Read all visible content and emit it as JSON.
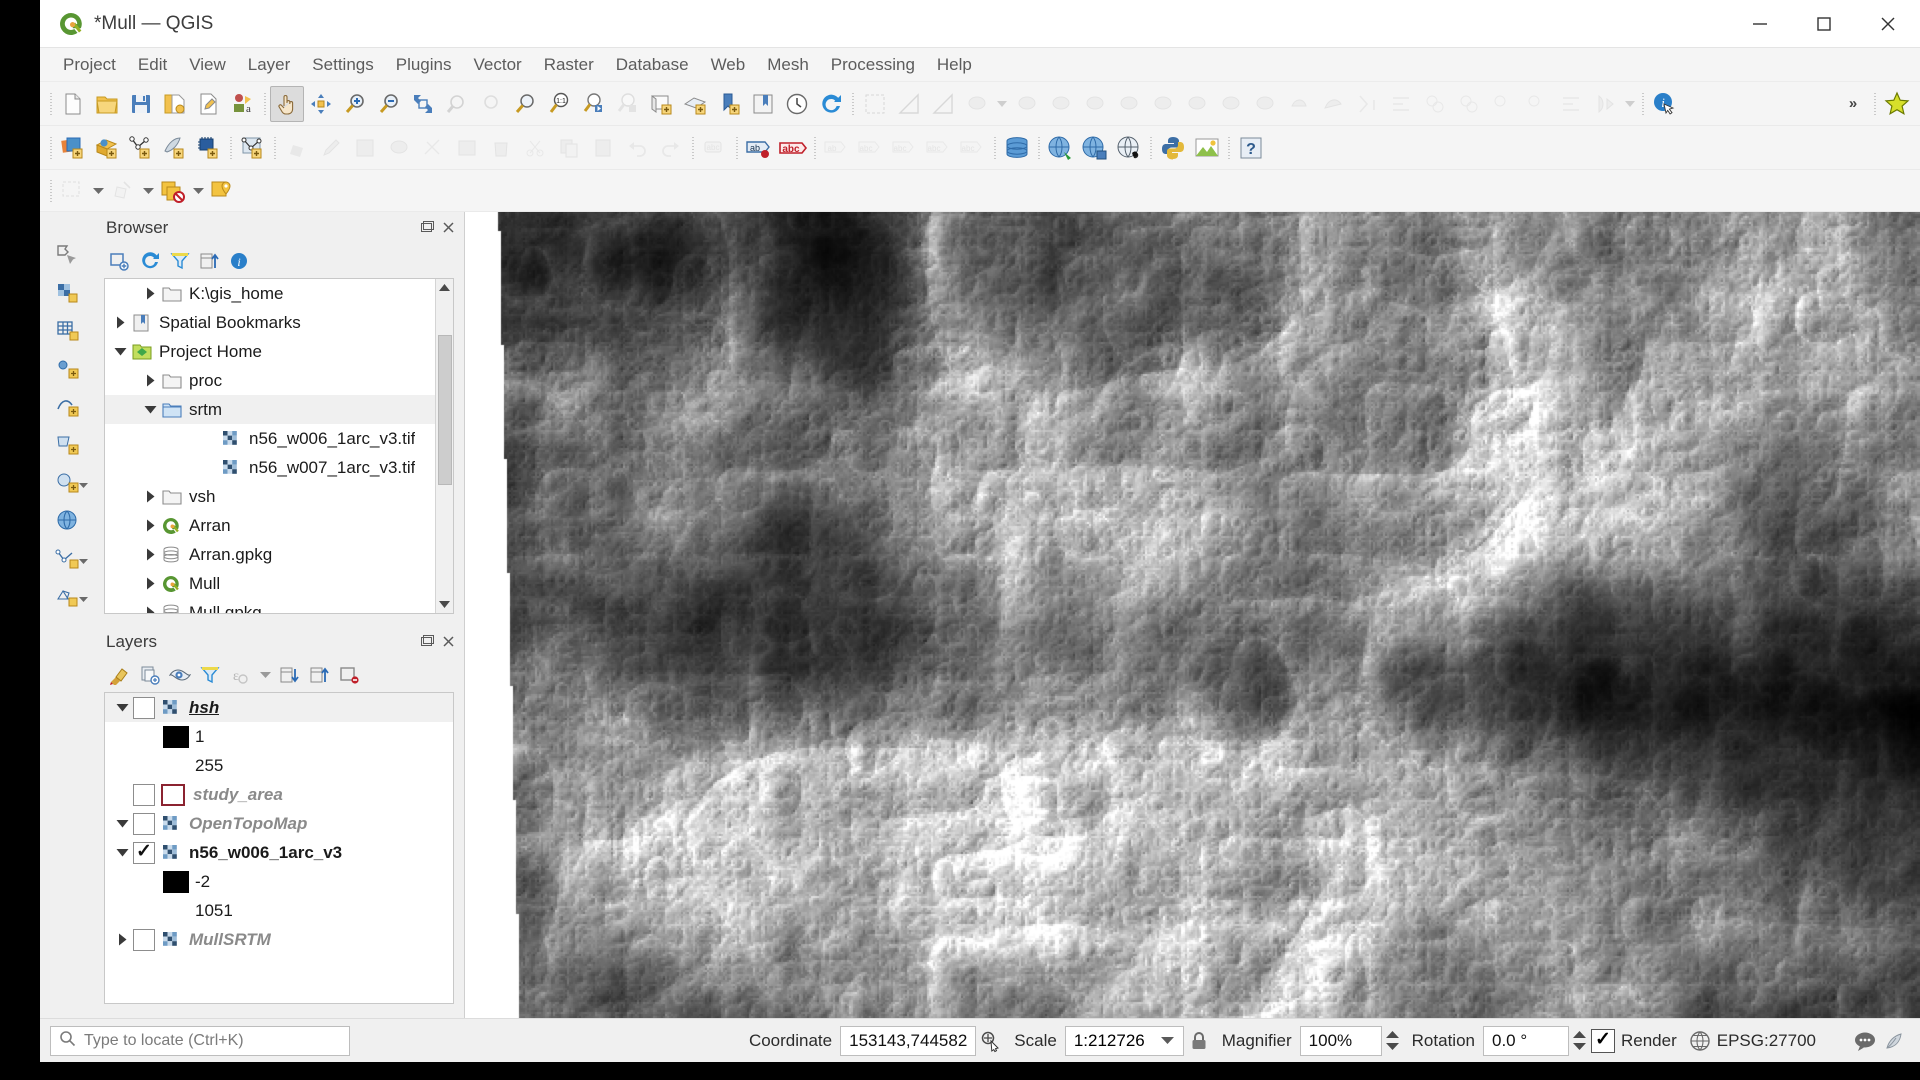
{
  "window": {
    "title": "*Mull — QGIS",
    "logo_icon": "qgis-logo-icon",
    "minimize_label": "—",
    "maximize_label": "▢",
    "close_label": "✕"
  },
  "menubar": {
    "items": [
      {
        "label": "Project"
      },
      {
        "label": "Edit"
      },
      {
        "label": "View"
      },
      {
        "label": "Layer"
      },
      {
        "label": "Settings"
      },
      {
        "label": "Plugins"
      },
      {
        "label": "Vector"
      },
      {
        "label": "Raster"
      },
      {
        "label": "Database"
      },
      {
        "label": "Web"
      },
      {
        "label": "Mesh"
      },
      {
        "label": "Processing"
      },
      {
        "label": "Help"
      }
    ]
  },
  "toolbar_project": {
    "items": [
      {
        "name": "new-project-icon",
        "enabled": true
      },
      {
        "name": "open-project-icon",
        "enabled": true
      },
      {
        "name": "save-project-icon",
        "enabled": true
      },
      {
        "name": "save-project-as-icon",
        "enabled": true
      },
      {
        "name": "project-properties-icon",
        "enabled": true
      },
      {
        "name": "style-manager-icon",
        "enabled": true
      },
      {
        "name": "pan-map-icon",
        "enabled": true,
        "pressed": true
      },
      {
        "name": "pan-to-selection-icon",
        "enabled": true
      },
      {
        "name": "zoom-in-icon",
        "enabled": true
      },
      {
        "name": "zoom-out-icon",
        "enabled": true
      },
      {
        "name": "zoom-full-icon",
        "enabled": true
      },
      {
        "name": "zoom-to-selection-icon",
        "enabled": false
      },
      {
        "name": "zoom-to-layer-icon",
        "enabled": true
      },
      {
        "name": "zoom-native-resolution-icon",
        "enabled": true
      },
      {
        "name": "zoom-last-icon",
        "enabled": true
      },
      {
        "name": "zoom-next-icon",
        "enabled": false
      },
      {
        "name": "new-map-view-icon",
        "enabled": true
      },
      {
        "name": "new-3d-map-view-icon",
        "enabled": true
      },
      {
        "name": "new-bookmark-icon",
        "enabled": true
      },
      {
        "name": "show-bookmarks-icon",
        "enabled": true
      },
      {
        "name": "temporal-controller-icon",
        "enabled": true
      },
      {
        "name": "refresh-icon",
        "enabled": true
      },
      {
        "name": "identify-features-icon",
        "enabled": true
      },
      {
        "name": "measure-line-icon",
        "enabled": false
      },
      {
        "name": "measure-area-icon",
        "enabled": false
      }
    ],
    "overflow_label": "»"
  },
  "toolbar_digitizing": {
    "items": [
      {
        "name": "add-vector-layer-icon",
        "enabled": true
      },
      {
        "name": "add-raster-layer-icon",
        "enabled": true
      },
      {
        "name": "add-delimited-text-layer-icon",
        "enabled": true
      },
      {
        "name": "add-spatialite-layer-icon",
        "enabled": true
      },
      {
        "name": "add-postgis-layer-icon",
        "enabled": true
      },
      {
        "name": "add-mesh-layer-icon",
        "enabled": true
      },
      {
        "name": "current-edits-icon",
        "enabled": false
      },
      {
        "name": "toggle-editing-icon",
        "enabled": false
      },
      {
        "name": "save-layer-edits-icon",
        "enabled": false
      },
      {
        "name": "add-polygon-feature-icon",
        "enabled": false
      },
      {
        "name": "vertex-tool-icon",
        "enabled": false
      },
      {
        "name": "modify-attributes-icon",
        "enabled": false
      },
      {
        "name": "delete-selected-icon",
        "enabled": false
      },
      {
        "name": "cut-features-icon",
        "enabled": false
      },
      {
        "name": "copy-features-icon",
        "enabled": false
      },
      {
        "name": "paste-features-icon",
        "enabled": false
      },
      {
        "name": "undo-icon",
        "enabled": false
      },
      {
        "name": "redo-icon",
        "enabled": false
      },
      {
        "name": "label-toggle-icon",
        "enabled": false
      },
      {
        "name": "layer-labeling-options-icon",
        "enabled": true
      },
      {
        "name": "highlight-pinned-labels-icon",
        "enabled": true
      },
      {
        "name": "pin-labels-icon",
        "enabled": false
      },
      {
        "name": "show-hide-labels-icon",
        "enabled": false
      },
      {
        "name": "move-label-icon",
        "enabled": false
      },
      {
        "name": "rotate-label-icon",
        "enabled": false
      },
      {
        "name": "change-label-icon",
        "enabled": false
      },
      {
        "name": "database-manager-icon",
        "enabled": true
      },
      {
        "name": "metasearch-icon",
        "enabled": true
      },
      {
        "name": "qgis-server-icon",
        "enabled": true
      },
      {
        "name": "georeferencer-icon",
        "enabled": true
      },
      {
        "name": "python-console-icon",
        "enabled": true
      },
      {
        "name": "plugin-manager-icon",
        "enabled": true
      },
      {
        "name": "help-contents-icon",
        "enabled": true
      }
    ]
  },
  "toolbar_selection": {
    "items": [
      {
        "name": "select-features-icon",
        "enabled": false
      },
      {
        "name": "deselect-features-icon",
        "enabled": true
      },
      {
        "name": "select-by-value-icon",
        "enabled": true
      },
      {
        "name": "select-by-location-icon",
        "enabled": true
      }
    ]
  },
  "rail": {
    "items": [
      {
        "name": "rail-item-select-features",
        "icon": "select-polygon-icon"
      },
      {
        "name": "rail-item-raster-calculator",
        "icon": "raster-icon"
      },
      {
        "name": "rail-item-vector-grid",
        "icon": "grid-icon"
      },
      {
        "name": "rail-item-add-point",
        "icon": "add-point-icon"
      },
      {
        "name": "rail-item-add-line",
        "icon": "add-line-icon"
      },
      {
        "name": "rail-item-add-polygon",
        "icon": "add-polygon-icon"
      },
      {
        "name": "rail-item-add-circle",
        "icon": "add-circle-icon"
      },
      {
        "name": "rail-item-globe",
        "icon": "globe-icon"
      },
      {
        "name": "rail-item-vertex-tool",
        "icon": "vertex-tool-icon"
      },
      {
        "name": "rail-item-mesh",
        "icon": "mesh-icon"
      }
    ]
  },
  "browser_panel": {
    "title": "Browser",
    "toolbar": [
      {
        "name": "add-layer-icon"
      },
      {
        "name": "refresh-icon"
      },
      {
        "name": "filter-browser-icon"
      },
      {
        "name": "collapse-all-icon"
      },
      {
        "name": "show-properties-icon"
      }
    ],
    "tree": [
      {
        "label": "K:\\gis_home",
        "icon": "folder-icon",
        "indent": 2,
        "twisty": "collapsed",
        "style": "normal"
      },
      {
        "label": "Spatial Bookmarks",
        "icon": "bookmarks-icon",
        "indent": 1,
        "twisty": "collapsed",
        "style": "normal"
      },
      {
        "label": "Project Home",
        "icon": "project-home-icon",
        "indent": 1,
        "twisty": "expanded",
        "style": "normal"
      },
      {
        "label": "proc",
        "icon": "folder-icon",
        "indent": 2,
        "twisty": "collapsed",
        "style": "normal"
      },
      {
        "label": "srtm",
        "icon": "folder-open-icon",
        "indent": 2,
        "twisty": "expanded",
        "style": "normal",
        "selected": true
      },
      {
        "label": "n56_w006_1arc_v3.tif",
        "icon": "raster-icon",
        "indent": 4,
        "twisty": "none",
        "style": "normal"
      },
      {
        "label": "n56_w007_1arc_v3.tif",
        "icon": "raster-icon",
        "indent": 4,
        "twisty": "none",
        "style": "normal"
      },
      {
        "label": "vsh",
        "icon": "folder-icon",
        "indent": 2,
        "twisty": "collapsed",
        "style": "normal"
      },
      {
        "label": "Arran",
        "icon": "qgis-project-icon",
        "indent": 2,
        "twisty": "collapsed",
        "style": "normal"
      },
      {
        "label": "Arran.gpkg",
        "icon": "geopackage-icon",
        "indent": 2,
        "twisty": "collapsed",
        "style": "normal"
      },
      {
        "label": "Mull",
        "icon": "qgis-project-icon",
        "indent": 2,
        "twisty": "collapsed",
        "style": "normal"
      },
      {
        "label": "Mull.gpkg",
        "icon": "geopackage-icon",
        "indent": 2,
        "twisty": "collapsed",
        "style": "normal"
      }
    ]
  },
  "layers_panel": {
    "title": "Layers",
    "toolbar": [
      {
        "name": "open-layer-styling-panel-icon"
      },
      {
        "name": "add-group-icon"
      },
      {
        "name": "manage-map-themes-icon"
      },
      {
        "name": "filter-legend-icon"
      },
      {
        "name": "filter-legend-by-expression-icon"
      },
      {
        "name": "expand-all-icon"
      },
      {
        "name": "collapse-all-icon"
      },
      {
        "name": "remove-layer-icon"
      }
    ],
    "tree": [
      {
        "label": "hsh",
        "kind": "layer",
        "twisty": "expanded",
        "checked": false,
        "icon": "raster-icon",
        "style": "active-italic-bold"
      },
      {
        "label": "1",
        "kind": "ramp-min",
        "swatch": "black",
        "indent": 1
      },
      {
        "label": "255",
        "kind": "ramp-max",
        "swatch": "none",
        "indent": 1
      },
      {
        "label": "study_area",
        "kind": "layer",
        "twisty": "none",
        "checked": false,
        "icon": "polygon-outline-icon",
        "style": "gray-italic"
      },
      {
        "label": "OpenTopoMap",
        "kind": "layer",
        "twisty": "expanded",
        "checked": false,
        "icon": "raster-icon",
        "style": "gray-italic"
      },
      {
        "label": "n56_w006_1arc_v3",
        "kind": "layer",
        "twisty": "expanded",
        "checked": true,
        "icon": "raster-icon",
        "style": "bold"
      },
      {
        "label": "-2",
        "kind": "ramp-min",
        "swatch": "black",
        "indent": 1
      },
      {
        "label": "1051",
        "kind": "ramp-max",
        "swatch": "none",
        "indent": 1
      },
      {
        "label": "MullSRTM",
        "kind": "layer",
        "twisty": "collapsed",
        "checked": false,
        "icon": "raster-icon",
        "style": "gray-italic"
      }
    ]
  },
  "statusbar": {
    "locator_placeholder": "Type to locate (Ctrl+K)",
    "locator_icon": "search-icon",
    "coordinate_label": "Coordinate",
    "coordinate_value": "153143,744582",
    "coordinate_toggle_icon": "toggle-extents-icon",
    "scale_label": "Scale",
    "scale_value": "1:212726",
    "scale_dropdown_icon": "chevron-down-icon",
    "lock_icon": "lock-scale-icon",
    "magnifier_label": "Magnifier",
    "magnifier_value": "100%",
    "rotation_label": "Rotation",
    "rotation_value": "0.0 °",
    "render_label": "Render",
    "render_checked": true,
    "crs_icon": "crs-globe-icon",
    "crs_label": "EPSG:27700",
    "messages_icon": "messages-icon",
    "plugin-status_icon": "log-messages-icon"
  },
  "map": {
    "name": "map-canvas",
    "raster_description": "Grayscale SRTM hillshade / DEM of Mull"
  },
  "colors": {
    "accent": "#4a90c9",
    "chrome": "#f0f0f0",
    "panel_bg": "#ffffff",
    "text": "#1b1b1b",
    "muted_text": "#8a8a8a"
  }
}
